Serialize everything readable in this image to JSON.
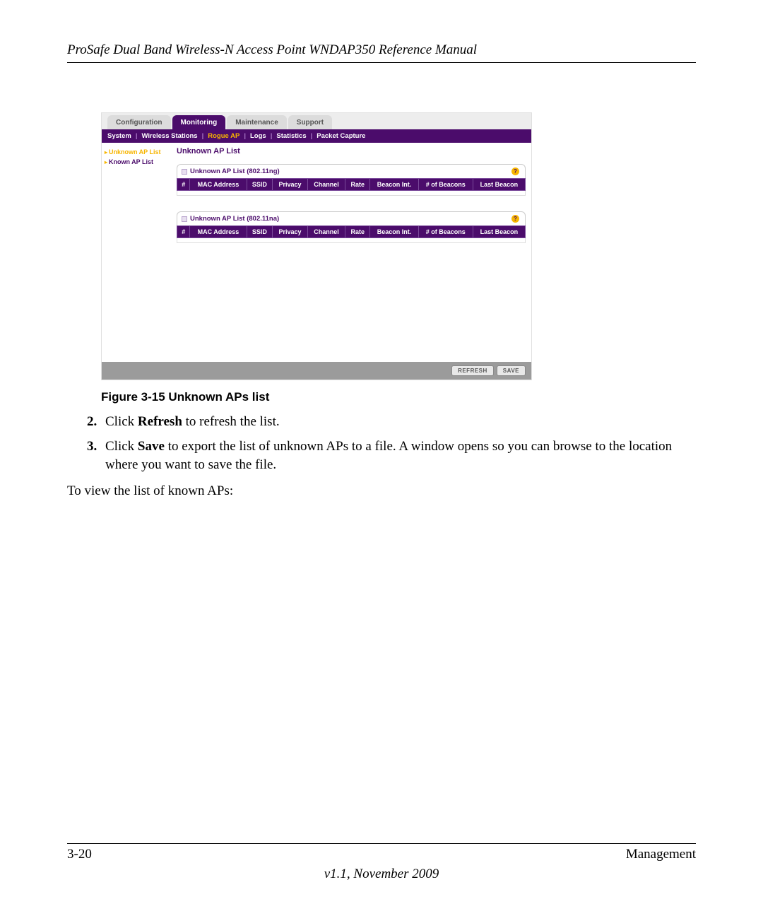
{
  "header": {
    "title": "ProSafe Dual Band Wireless-N Access Point WNDAP350 Reference Manual"
  },
  "screenshot": {
    "topTabs": {
      "configuration": "Configuration",
      "monitoring": "Monitoring",
      "maintenance": "Maintenance",
      "support": "Support"
    },
    "subnav": {
      "system": "System",
      "wirelessStations": "Wireless Stations",
      "rogueAp": "Rogue AP",
      "logs": "Logs",
      "statistics": "Statistics",
      "packetCapture": "Packet Capture"
    },
    "sidebar": {
      "unknown": "Unknown AP List",
      "known": "Known AP List"
    },
    "mainTitle": "Unknown AP List",
    "panel1Title": "Unknown AP List (802.11ng)",
    "panel2Title": "Unknown AP List (802.11na)",
    "columns": {
      "num": "#",
      "mac": "MAC Address",
      "ssid": "SSID",
      "privacy": "Privacy",
      "channel": "Channel",
      "rate": "Rate",
      "beaconInt": "Beacon Int.",
      "beaconsNum": "# of Beacons",
      "lastBeacon": "Last Beacon"
    },
    "buttons": {
      "refresh": "REFRESH",
      "save": "SAVE"
    }
  },
  "caption": "Figure 3-15  Unknown APs list",
  "steps": {
    "num2": "2.",
    "text2a": "Click ",
    "text2b": "Refresh",
    "text2c": " to refresh the list.",
    "num3": "3.",
    "text3a": "Click ",
    "text3b": "Save",
    "text3c": " to export the list of unknown APs to a file. A window opens so you can browse to the location where you want to save the file."
  },
  "bodyNext": "To view the list of known APs:",
  "footer": {
    "pageNum": "3-20",
    "section": "Management",
    "version": "v1.1, November 2009"
  }
}
